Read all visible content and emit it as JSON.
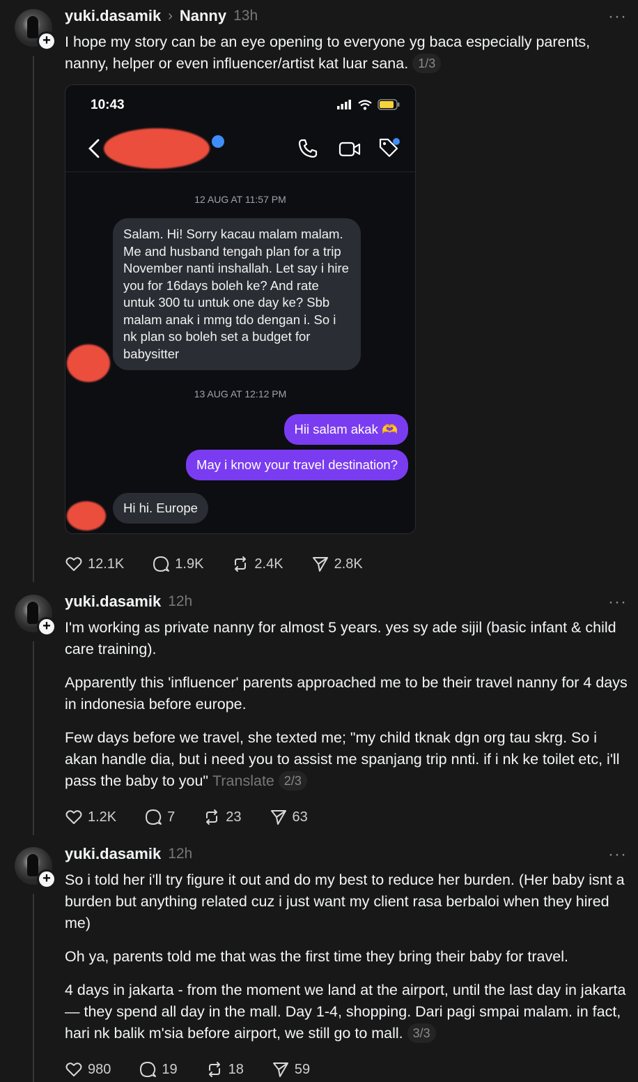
{
  "posts": [
    {
      "username": "yuki.dasamik",
      "topic": "Nanny",
      "time": "13h",
      "paragraphs": [
        "I hope my story can be an eye opening to everyone yg baca especially parents, nanny, helper or even influencer/artist kat luar sana."
      ],
      "page": "1/3",
      "likes": "12.1K",
      "comments": "1.9K",
      "reposts": "2.4K",
      "shares": "2.8K"
    },
    {
      "username": "yuki.dasamik",
      "time": "12h",
      "paragraphs": [
        "I'm working as private nanny for almost 5 years. yes sy ade sijil (basic infant & child care training).",
        "Apparently this 'influencer' parents approached me to be their travel nanny for 4 days in indonesia before europe.",
        "Few days before we travel, she texted me; \"my child tknak dgn org tau skrg. So i akan handle dia, but i need you to assist me spanjang trip nnti. if i nk ke toilet etc, i'll pass the baby to you\""
      ],
      "translate": "Translate",
      "page": "2/3",
      "likes": "1.2K",
      "comments": "7",
      "reposts": "23",
      "shares": "63"
    },
    {
      "username": "yuki.dasamik",
      "time": "12h",
      "paragraphs": [
        "So i told her i'll try figure it out and do my best to reduce her burden. (Her baby isnt a burden but anything related cuz i just want my client rasa berbaloi when they hired me)",
        "Oh ya, parents told me that was the first time they bring their baby for travel.",
        "4 days in jakarta - from the moment we land at the airport, until the last day in jakarta — they spend all day in the mall. Day 1-4, shopping. Dari pagi smpai malam. in fact, hari nk balik m'sia before airport, we still go to mall."
      ],
      "page": "3/3",
      "likes": "980",
      "comments": "19",
      "reposts": "18",
      "shares": "59"
    }
  ],
  "screenshot": {
    "clock": "10:43",
    "timestamp1": "12 AUG AT 11:57 PM",
    "msg1": "Salam. Hi! Sorry kacau malam malam. Me and husband tengah plan for a trip November nanti inshallah. Let say i hire you for 16days boleh ke? And rate untuk 300 tu untuk one day ke? Sbb malam anak i mmg tdo dengan i. So i nk plan so boleh set a budget for babysitter",
    "timestamp2": "13 AUG AT 12:12 PM",
    "reply1": "Hii salam akak 🫶",
    "reply2": "May i know your travel destination?",
    "msg2": "Hi hi. Europe",
    "redact_color": "#ec4e3e",
    "bubble_out_color": "#7a3cf0"
  },
  "icons": [
    "more-icon",
    "heart-icon",
    "comment-icon",
    "repost-icon",
    "share-icon",
    "plus-icon"
  ]
}
